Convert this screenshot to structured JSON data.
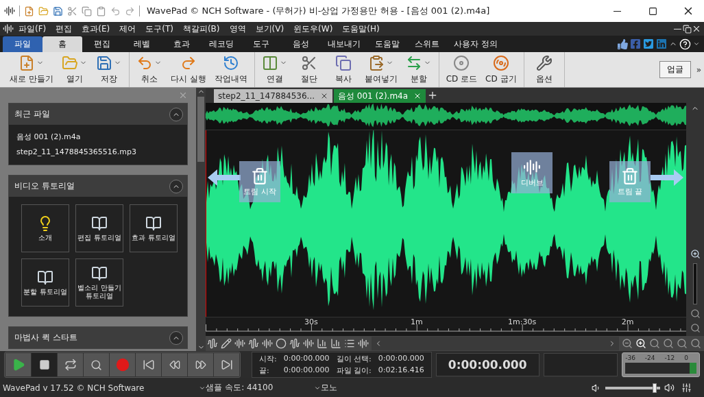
{
  "title_bar": {
    "title": "WavePad © NCH Software - (무허가) 비-상업 가정용만 허용 - [음성 001 (2).m4a]"
  },
  "menu_bar": [
    "파일(F)",
    "편집",
    "효과(E)",
    "제어",
    "도구(T)",
    "책갈피(B)",
    "영역",
    "보기(V)",
    "윈도우(W)",
    "도움말(H)"
  ],
  "ribbon_tabs": [
    {
      "label": "파일",
      "kind": "file",
      "selected": false
    },
    {
      "label": "홈",
      "kind": "tab",
      "selected": true
    },
    {
      "label": "편집",
      "kind": "tab",
      "selected": false
    },
    {
      "label": "레벨",
      "kind": "tab",
      "selected": false
    },
    {
      "label": "효과",
      "kind": "tab",
      "selected": false
    },
    {
      "label": "레코딩",
      "kind": "tab",
      "selected": false
    },
    {
      "label": "도구",
      "kind": "tab",
      "selected": false
    },
    {
      "label": "음성",
      "kind": "tab",
      "selected": false
    },
    {
      "label": "내보내기",
      "kind": "tab",
      "selected": false
    },
    {
      "label": "도움말",
      "kind": "tab",
      "selected": false
    },
    {
      "label": "스위트",
      "kind": "tab",
      "selected": false
    },
    {
      "label": "사용자 정의",
      "kind": "tab",
      "selected": false
    }
  ],
  "toolbar": {
    "groups": [
      [
        {
          "label": "새로 만들기",
          "dropdown": true
        },
        {
          "label": "열기",
          "dropdown": true
        },
        {
          "label": "저장",
          "dropdown": true
        }
      ],
      [
        {
          "label": "취소",
          "dropdown": true
        },
        {
          "label": "다시 실행",
          "dropdown": false
        },
        {
          "label": "작업내역",
          "dropdown": false
        }
      ],
      [
        {
          "label": "연결",
          "dropdown": true
        },
        {
          "label": "절단",
          "dropdown": false
        },
        {
          "label": "복사",
          "dropdown": false
        },
        {
          "label": "붙여넣기",
          "dropdown": true
        },
        {
          "label": "분할",
          "dropdown": true
        }
      ],
      [
        {
          "label": "CD 로드",
          "dropdown": false
        },
        {
          "label": "CD 굽기",
          "dropdown": false
        }
      ],
      [
        {
          "label": "옵션",
          "dropdown": false
        }
      ]
    ],
    "upgrade": "업글",
    "more": "»"
  },
  "documents": [
    {
      "label": "step2_11_147884536...",
      "selected": false
    },
    {
      "label": "음성 001 (2).m4a",
      "selected": true
    }
  ],
  "side_panel": {
    "sections": [
      {
        "title": "최근 파일",
        "kind": "files",
        "items": [
          "음성 001 (2).m4a",
          "step2_11_1478845365516.mp3"
        ]
      },
      {
        "title": "비디오 튜토리얼",
        "kind": "tiles",
        "items": [
          "소개",
          "편집 튜토리얼",
          "효과 튜토리얼",
          "분할 튜토리얼",
          "벨소리 만들기 튜토리얼"
        ]
      },
      {
        "title": "마법사 퀵 스타트",
        "kind": "header"
      }
    ]
  },
  "waveform": {
    "overlays": [
      {
        "label": "트림 시작",
        "kind": "trim_start"
      },
      {
        "label": "디버브",
        "kind": "dereverb"
      },
      {
        "label": "트림 끝",
        "kind": "trim_end"
      }
    ],
    "ruler": [
      "30s",
      "1m",
      "1m:30s",
      "2m"
    ]
  },
  "transport": {
    "info": [
      {
        "label": "시작:",
        "value": "0:00:00.000"
      },
      {
        "label": "길이 선택:",
        "value": "0:00:00.000"
      },
      {
        "label": "끝:",
        "value": "0:00:00.000"
      },
      {
        "label": "파일 길이:",
        "value": "0:02:16.416"
      }
    ],
    "time": "0:00:00.000",
    "meter_scale": [
      "-36",
      "-24",
      "-12",
      "0"
    ]
  },
  "status_bar": {
    "version": "WavePad v 17.52 © NCH Software",
    "sample_rate": "샘플 속도: 44100",
    "channels": "모노",
    "volume": {
      "level": 0.9
    }
  }
}
